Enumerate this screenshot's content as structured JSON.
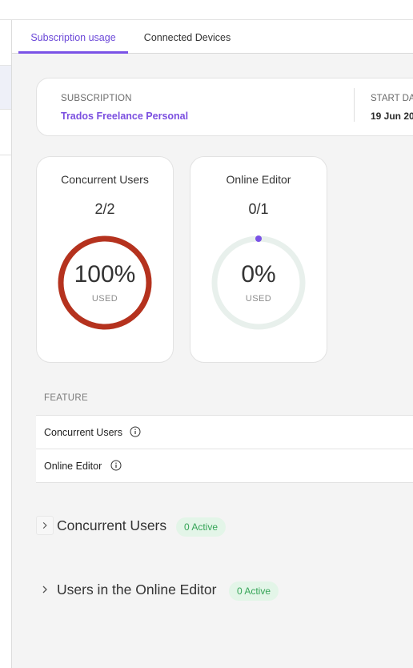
{
  "tabs": [
    {
      "label": "Subscription usage",
      "active": true
    },
    {
      "label": "Connected Devices",
      "active": false
    }
  ],
  "subscription": {
    "label": "SUBSCRIPTION",
    "value": "Trados Freelance Personal",
    "start_label": "START DA",
    "start_value": "19 Jun 20"
  },
  "gauges": [
    {
      "title": "Concurrent Users",
      "count": "2/2",
      "percent_label": "100%",
      "used_label": "USED",
      "fraction": 1.0,
      "color": "#b5321e"
    },
    {
      "title": "Online Editor",
      "count": "0/1",
      "percent_label": "0%",
      "used_label": "USED",
      "fraction": 0.0,
      "color": "#7a52e6"
    }
  ],
  "features": {
    "header": "FEATURE",
    "rows": [
      {
        "label": "Concurrent Users",
        "icon": "info-icon"
      },
      {
        "label": "Online Editor",
        "icon": "info-icon"
      }
    ]
  },
  "sections": [
    {
      "title": "Concurrent Users",
      "badge": "0 Active"
    },
    {
      "title": "Users in the Online Editor",
      "badge": "0 Active"
    }
  ],
  "colors": {
    "accent": "#7a52e6",
    "gauge_full": "#b5321e",
    "gauge_track": "#e8f0ec",
    "badge_bg": "#e3f5e8",
    "badge_text": "#35a457"
  }
}
